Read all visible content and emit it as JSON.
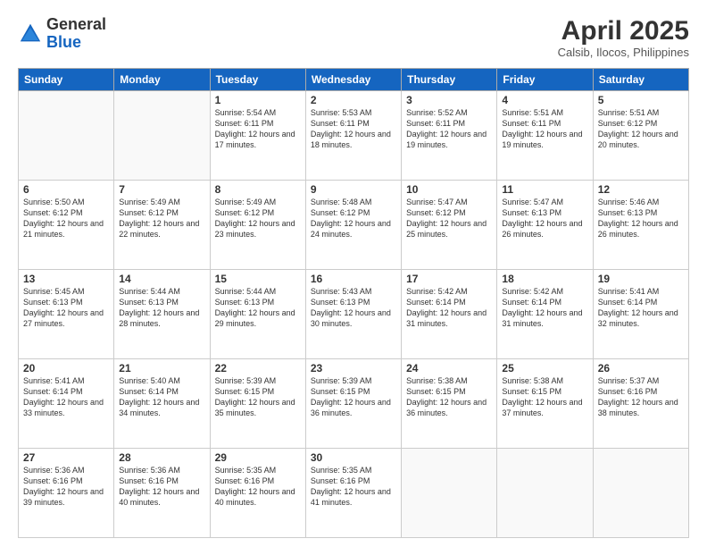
{
  "logo": {
    "general": "General",
    "blue": "Blue"
  },
  "title": "April 2025",
  "subtitle": "Calsib, Ilocos, Philippines",
  "headers": [
    "Sunday",
    "Monday",
    "Tuesday",
    "Wednesday",
    "Thursday",
    "Friday",
    "Saturday"
  ],
  "weeks": [
    [
      {
        "day": "",
        "sunrise": "",
        "sunset": "",
        "daylight": "",
        "empty": true
      },
      {
        "day": "",
        "sunrise": "",
        "sunset": "",
        "daylight": "",
        "empty": true
      },
      {
        "day": "1",
        "sunrise": "Sunrise: 5:54 AM",
        "sunset": "Sunset: 6:11 PM",
        "daylight": "Daylight: 12 hours and 17 minutes.",
        "empty": false
      },
      {
        "day": "2",
        "sunrise": "Sunrise: 5:53 AM",
        "sunset": "Sunset: 6:11 PM",
        "daylight": "Daylight: 12 hours and 18 minutes.",
        "empty": false
      },
      {
        "day": "3",
        "sunrise": "Sunrise: 5:52 AM",
        "sunset": "Sunset: 6:11 PM",
        "daylight": "Daylight: 12 hours and 19 minutes.",
        "empty": false
      },
      {
        "day": "4",
        "sunrise": "Sunrise: 5:51 AM",
        "sunset": "Sunset: 6:11 PM",
        "daylight": "Daylight: 12 hours and 19 minutes.",
        "empty": false
      },
      {
        "day": "5",
        "sunrise": "Sunrise: 5:51 AM",
        "sunset": "Sunset: 6:12 PM",
        "daylight": "Daylight: 12 hours and 20 minutes.",
        "empty": false
      }
    ],
    [
      {
        "day": "6",
        "sunrise": "Sunrise: 5:50 AM",
        "sunset": "Sunset: 6:12 PM",
        "daylight": "Daylight: 12 hours and 21 minutes.",
        "empty": false
      },
      {
        "day": "7",
        "sunrise": "Sunrise: 5:49 AM",
        "sunset": "Sunset: 6:12 PM",
        "daylight": "Daylight: 12 hours and 22 minutes.",
        "empty": false
      },
      {
        "day": "8",
        "sunrise": "Sunrise: 5:49 AM",
        "sunset": "Sunset: 6:12 PM",
        "daylight": "Daylight: 12 hours and 23 minutes.",
        "empty": false
      },
      {
        "day": "9",
        "sunrise": "Sunrise: 5:48 AM",
        "sunset": "Sunset: 6:12 PM",
        "daylight": "Daylight: 12 hours and 24 minutes.",
        "empty": false
      },
      {
        "day": "10",
        "sunrise": "Sunrise: 5:47 AM",
        "sunset": "Sunset: 6:12 PM",
        "daylight": "Daylight: 12 hours and 25 minutes.",
        "empty": false
      },
      {
        "day": "11",
        "sunrise": "Sunrise: 5:47 AM",
        "sunset": "Sunset: 6:13 PM",
        "daylight": "Daylight: 12 hours and 26 minutes.",
        "empty": false
      },
      {
        "day": "12",
        "sunrise": "Sunrise: 5:46 AM",
        "sunset": "Sunset: 6:13 PM",
        "daylight": "Daylight: 12 hours and 26 minutes.",
        "empty": false
      }
    ],
    [
      {
        "day": "13",
        "sunrise": "Sunrise: 5:45 AM",
        "sunset": "Sunset: 6:13 PM",
        "daylight": "Daylight: 12 hours and 27 minutes.",
        "empty": false
      },
      {
        "day": "14",
        "sunrise": "Sunrise: 5:44 AM",
        "sunset": "Sunset: 6:13 PM",
        "daylight": "Daylight: 12 hours and 28 minutes.",
        "empty": false
      },
      {
        "day": "15",
        "sunrise": "Sunrise: 5:44 AM",
        "sunset": "Sunset: 6:13 PM",
        "daylight": "Daylight: 12 hours and 29 minutes.",
        "empty": false
      },
      {
        "day": "16",
        "sunrise": "Sunrise: 5:43 AM",
        "sunset": "Sunset: 6:13 PM",
        "daylight": "Daylight: 12 hours and 30 minutes.",
        "empty": false
      },
      {
        "day": "17",
        "sunrise": "Sunrise: 5:42 AM",
        "sunset": "Sunset: 6:14 PM",
        "daylight": "Daylight: 12 hours and 31 minutes.",
        "empty": false
      },
      {
        "day": "18",
        "sunrise": "Sunrise: 5:42 AM",
        "sunset": "Sunset: 6:14 PM",
        "daylight": "Daylight: 12 hours and 31 minutes.",
        "empty": false
      },
      {
        "day": "19",
        "sunrise": "Sunrise: 5:41 AM",
        "sunset": "Sunset: 6:14 PM",
        "daylight": "Daylight: 12 hours and 32 minutes.",
        "empty": false
      }
    ],
    [
      {
        "day": "20",
        "sunrise": "Sunrise: 5:41 AM",
        "sunset": "Sunset: 6:14 PM",
        "daylight": "Daylight: 12 hours and 33 minutes.",
        "empty": false
      },
      {
        "day": "21",
        "sunrise": "Sunrise: 5:40 AM",
        "sunset": "Sunset: 6:14 PM",
        "daylight": "Daylight: 12 hours and 34 minutes.",
        "empty": false
      },
      {
        "day": "22",
        "sunrise": "Sunrise: 5:39 AM",
        "sunset": "Sunset: 6:15 PM",
        "daylight": "Daylight: 12 hours and 35 minutes.",
        "empty": false
      },
      {
        "day": "23",
        "sunrise": "Sunrise: 5:39 AM",
        "sunset": "Sunset: 6:15 PM",
        "daylight": "Daylight: 12 hours and 36 minutes.",
        "empty": false
      },
      {
        "day": "24",
        "sunrise": "Sunrise: 5:38 AM",
        "sunset": "Sunset: 6:15 PM",
        "daylight": "Daylight: 12 hours and 36 minutes.",
        "empty": false
      },
      {
        "day": "25",
        "sunrise": "Sunrise: 5:38 AM",
        "sunset": "Sunset: 6:15 PM",
        "daylight": "Daylight: 12 hours and 37 minutes.",
        "empty": false
      },
      {
        "day": "26",
        "sunrise": "Sunrise: 5:37 AM",
        "sunset": "Sunset: 6:16 PM",
        "daylight": "Daylight: 12 hours and 38 minutes.",
        "empty": false
      }
    ],
    [
      {
        "day": "27",
        "sunrise": "Sunrise: 5:36 AM",
        "sunset": "Sunset: 6:16 PM",
        "daylight": "Daylight: 12 hours and 39 minutes.",
        "empty": false
      },
      {
        "day": "28",
        "sunrise": "Sunrise: 5:36 AM",
        "sunset": "Sunset: 6:16 PM",
        "daylight": "Daylight: 12 hours and 40 minutes.",
        "empty": false
      },
      {
        "day": "29",
        "sunrise": "Sunrise: 5:35 AM",
        "sunset": "Sunset: 6:16 PM",
        "daylight": "Daylight: 12 hours and 40 minutes.",
        "empty": false
      },
      {
        "day": "30",
        "sunrise": "Sunrise: 5:35 AM",
        "sunset": "Sunset: 6:16 PM",
        "daylight": "Daylight: 12 hours and 41 minutes.",
        "empty": false
      },
      {
        "day": "",
        "sunrise": "",
        "sunset": "",
        "daylight": "",
        "empty": true
      },
      {
        "day": "",
        "sunrise": "",
        "sunset": "",
        "daylight": "",
        "empty": true
      },
      {
        "day": "",
        "sunrise": "",
        "sunset": "",
        "daylight": "",
        "empty": true
      }
    ]
  ]
}
